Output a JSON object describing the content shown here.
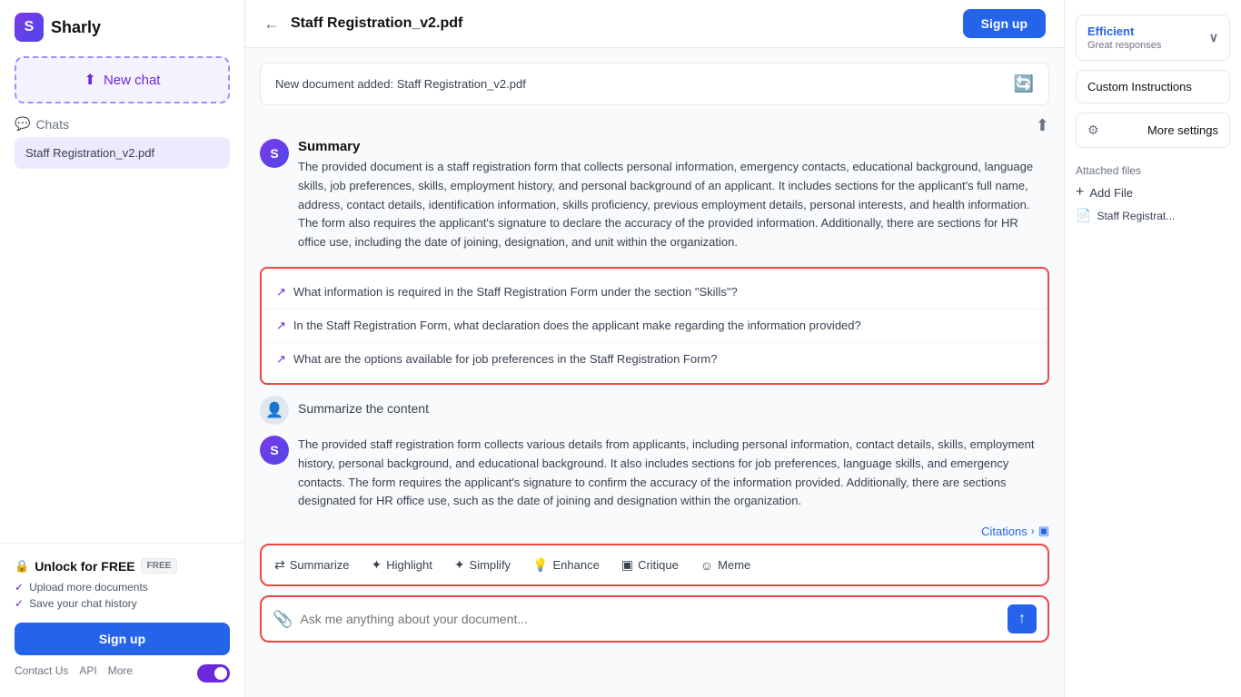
{
  "app": {
    "name": "Sharly",
    "logo_letter": "S"
  },
  "sidebar": {
    "new_chat_label": "New chat",
    "chats_label": "Chats",
    "chat_item": "Staff Registration_v2.pdf",
    "unlock_title": "Unlock for FREE",
    "free_badge": "FREE",
    "unlock_items": [
      "Upload more documents",
      "Save your chat history"
    ],
    "sign_up_label": "Sign up",
    "footer_links": [
      "Contact Us",
      "API",
      "More"
    ]
  },
  "topbar": {
    "doc_title": "Staff Registration_v2.pdf",
    "sign_up_label": "Sign up"
  },
  "doc_banner": {
    "text": "New document added: Staff Registration_v2.pdf"
  },
  "messages": [
    {
      "type": "ai",
      "title": "Summary",
      "text": "The provided document is a staff registration form that collects personal information, emergency contacts, educational background, language skills, job preferences, skills, employment history, and personal background of an applicant. It includes sections for the applicant's full name, address, contact details, identification information, skills proficiency, previous employment details, personal interests, and health information. The form also requires the applicant's signature to declare the accuracy of the provided information. Additionally, there are sections for HR office use, including the date of joining, designation, and unit within the organization."
    },
    {
      "type": "user",
      "text": "Summarize the content"
    },
    {
      "type": "ai",
      "title": "",
      "text": "The provided staff registration form collects various details from applicants, including personal information, contact details, skills, employment history, personal background, and educational background. It also includes sections for job preferences, language skills, and emergency contacts. The form requires the applicant's signature to confirm the accuracy of the information provided. Additionally, there are sections designated for HR office use, such as the date of joining and designation within the organization."
    }
  ],
  "questions": [
    "What information is required in the Staff Registration Form under the section \"Skills\"?",
    "In the Staff Registration Form, what declaration does the applicant make regarding the information provided?",
    "What are the options available for job preferences in the Staff Registration Form?"
  ],
  "citations_label": "Citations",
  "toolbar": {
    "buttons": [
      {
        "icon": "⇄",
        "label": "Summarize"
      },
      {
        "icon": "✦",
        "label": "Highlight"
      },
      {
        "icon": "✦",
        "label": "Simplify"
      },
      {
        "icon": "💡",
        "label": "Enhance"
      },
      {
        "icon": "▣",
        "label": "Critique"
      },
      {
        "icon": "☺",
        "label": "Meme"
      }
    ]
  },
  "input": {
    "placeholder": "Ask me anything about your document..."
  },
  "right_panel": {
    "efficient_label": "Efficient",
    "efficient_sub": "Great responses",
    "custom_instructions_label": "Custom Instructions",
    "more_settings_label": "More settings",
    "attached_files_label": "Attached files",
    "add_file_label": "Add File",
    "file_name": "Staff Registrat..."
  }
}
